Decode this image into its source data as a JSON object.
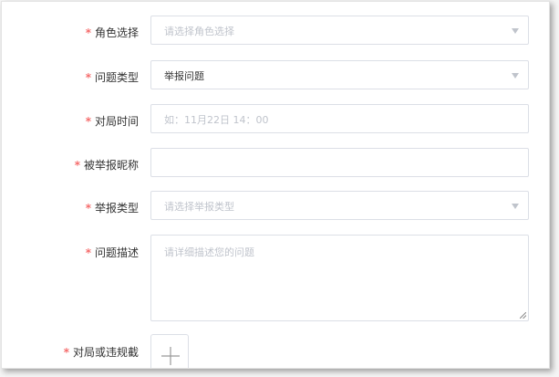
{
  "form": {
    "required_mark": "*",
    "role": {
      "label": "角色选择",
      "placeholder": "请选择角色选择"
    },
    "issue_type": {
      "label": "问题类型",
      "value": "举报问题"
    },
    "match_time": {
      "label": "对局时间",
      "placeholder": "如：11月22日 14：00"
    },
    "reported_nickname": {
      "label": "被举报昵称",
      "value": ""
    },
    "report_type": {
      "label": "举报类型",
      "placeholder": "请选择举报类型"
    },
    "description": {
      "label": "问题描述",
      "placeholder": "请详细描述您的问题"
    },
    "evidence": {
      "label": "对局或违规截"
    }
  },
  "icons": {
    "dropdown": "caret-down-icon",
    "upload": "plus-icon",
    "resize": "resize-handle-icon"
  },
  "colors": {
    "required": "#f56c6c",
    "border": "#dcdfe6",
    "placeholder": "#c0c4cc",
    "text": "#333333"
  }
}
